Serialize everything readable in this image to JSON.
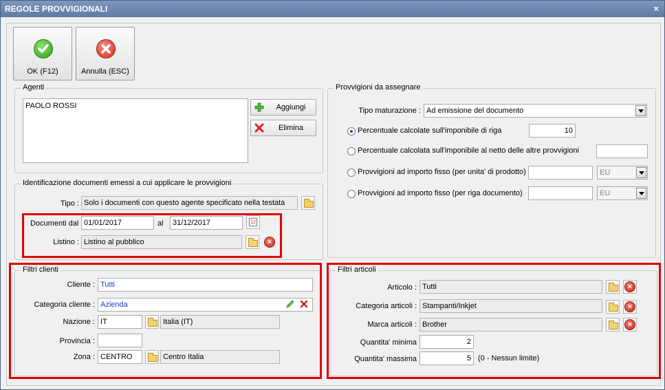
{
  "window": {
    "title": "REGOLE PROVVIGIONALI",
    "close": "×"
  },
  "toolbar": {
    "ok_label": "OK (F12)",
    "cancel_label": "Annulla (ESC)"
  },
  "agenti": {
    "legend": "Agenti",
    "list": [
      "PAOLO ROSSI"
    ],
    "add_label": "Aggiungi",
    "delete_label": "Elimina"
  },
  "provvigioni": {
    "legend": "Provvigioni da assegnare",
    "tipo_label": "Tipo maturazione :",
    "tipo_value": "Ad emissione del documento",
    "options": [
      {
        "label": "Percentuale calcolate sull'imponibile di riga",
        "value": "10",
        "selected": true
      },
      {
        "label": "Percentuale calcolata sull'imponibile al netto delle altre provvigioni",
        "value": "",
        "selected": false
      },
      {
        "label": "Provvigioni ad importo fisso (per unita' di prodotto)",
        "value": "",
        "currency": "EU",
        "selected": false
      },
      {
        "label": "Provvigioni ad importo fisso (per riga documento)",
        "value": "",
        "currency": "EU",
        "selected": false
      }
    ]
  },
  "identificazione": {
    "legend": "Identificazione documenti emessi a cui applicare le provvigioni",
    "tipo_label": "Tipo :",
    "tipo_value": "Solo i documenti con questo agente specificato nella testata",
    "dal_label": "Documenti dal",
    "dal_value": "01/01/2017",
    "al_label": "al",
    "al_value": "31/12/2017",
    "calendar_day": "12",
    "listino_label": "Listino :",
    "listino_value": "Listino al pubblico"
  },
  "filtri_clienti": {
    "legend": "Filtri clienti",
    "cliente_label": "Cliente :",
    "cliente_value": "Tutti",
    "categoria_label": "Categoria cliente :",
    "categoria_value": "Azienda",
    "nazione_label": "Nazione :",
    "nazione_code": "IT",
    "nazione_desc": "Italia (IT)",
    "provincia_label": "Provincia :",
    "provincia_value": "",
    "zona_label": "Zona :",
    "zona_code": "CENTRO",
    "zona_desc": "Centro Italia"
  },
  "filtri_articoli": {
    "legend": "Filtri articoli",
    "articolo_label": "Articolo :",
    "articolo_value": "Tutti",
    "categoria_label": "Categoria articoli :",
    "categoria_value": "Stampanti/Inkjet",
    "marca_label": "Marca articoli :",
    "marca_value": "Brother",
    "qmin_label": "Quantita' minima",
    "qmin_value": "2",
    "qmax_label": "Quantita' massima",
    "qmax_value": "5",
    "qmax_hint": "(0 - Nessun limite)"
  },
  "colors": {
    "highlight": "#e00000",
    "title_bar": "#6f89b0",
    "link_text": "#1a3fb5"
  }
}
